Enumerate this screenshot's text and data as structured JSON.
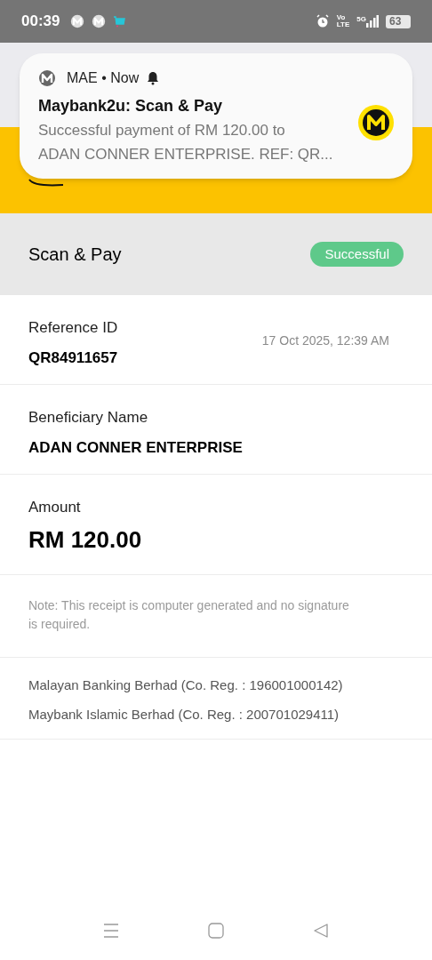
{
  "status_bar": {
    "time": "00:39",
    "network": "5G",
    "volte": [
      "Vo",
      "LTE"
    ],
    "battery": "63"
  },
  "notification": {
    "app": "MAE",
    "separator": "•",
    "time": "Now",
    "title": "Maybank2u: Scan & Pay",
    "body": [
      "Successful payment of RM 120.00 to",
      "ADAN CONNER ENTERPRISE. REF: QR..."
    ]
  },
  "receipt": {
    "title": "Scan & Pay",
    "status": "Successful",
    "sections": [
      {
        "kind": "reference",
        "label": "Reference ID",
        "value": "QR84911657",
        "date": "17 Oct 2025, 12:39 AM"
      },
      {
        "kind": "beneficiary",
        "label": "Beneficiary Name",
        "value": "ADAN CONNER ENTERPRISE"
      },
      {
        "kind": "amount",
        "label": "Amount",
        "value": "RM 120.00"
      }
    ],
    "note": "Note: This receipt is computer generated and no signature is required.",
    "companies": [
      "Malayan Banking Berhad (Co. Reg. : 196001000142)",
      "Maybank Islamic Berhad (Co. Reg. : 200701029411)"
    ]
  }
}
